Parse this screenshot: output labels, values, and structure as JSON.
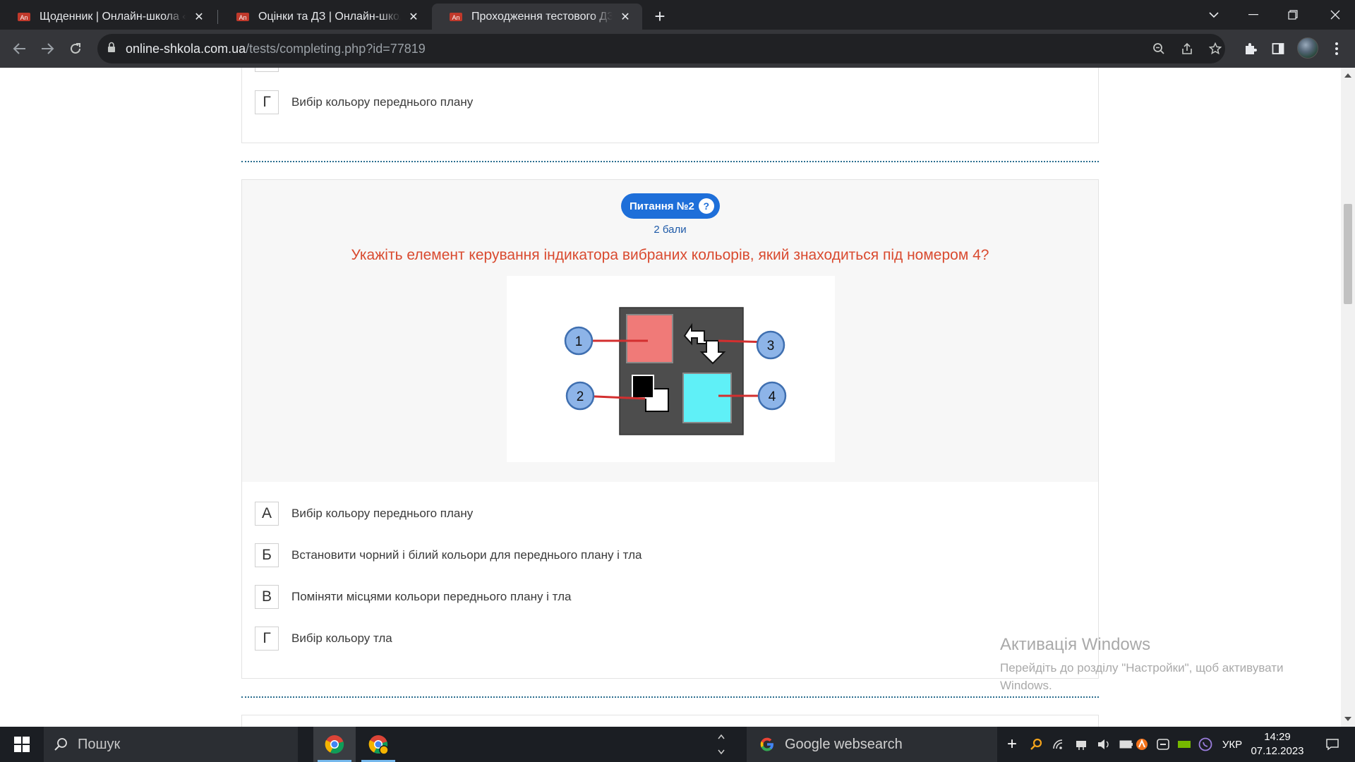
{
  "browser": {
    "tabs": [
      {
        "title": "Щоденник | Онлайн-школа «А",
        "active": false
      },
      {
        "title": "Оцінки та ДЗ | Онлайн-школа «",
        "active": false
      },
      {
        "title": "Проходження тестового ДЗ - С",
        "active": true
      }
    ],
    "address": {
      "host": "online-shkola.com.ua",
      "path": "/tests/completing.php?id=77819"
    }
  },
  "page": {
    "prev_question": {
      "answers": [
        {
          "letter": "Г",
          "text": "Вибір кольору переднього плану"
        }
      ]
    },
    "question": {
      "badge": "Питання №2",
      "help": "?",
      "points": "2 бали",
      "text": "Укажіть елемент керування індикатора вибраних кольорів, який знаходиться під номером 4?",
      "figure_labels": [
        "1",
        "2",
        "3",
        "4"
      ],
      "answers": [
        {
          "letter": "А",
          "text": "Вибір кольору переднього плану"
        },
        {
          "letter": "Б",
          "text": "Встановити чорний і білий кольори для переднього плану і тла"
        },
        {
          "letter": "В",
          "text": "Поміняти місцями кольори переднього плану і тла"
        },
        {
          "letter": "Г",
          "text": "Вибір кольору тла"
        }
      ]
    }
  },
  "watermark": {
    "title": "Активація Windows",
    "subtitle": "Перейдіть до розділу \"Настройки\", щоб активувати Windows."
  },
  "taskbar": {
    "search_placeholder": "Пошук",
    "google_search": "Google websearch",
    "language": "УКР",
    "time": "14:29",
    "date": "07.12.2023"
  },
  "colors": {
    "accent": "#1e6fd9",
    "question_text": "#d94a2f",
    "separator": "#2b6e8f"
  }
}
